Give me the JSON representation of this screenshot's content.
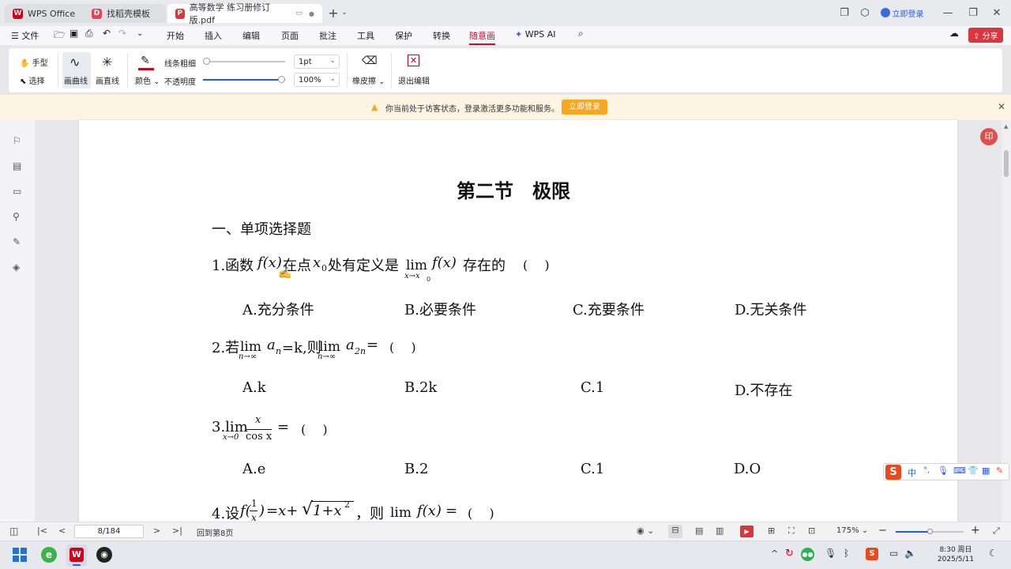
{
  "tabs": [
    {
      "label": "WPS Office",
      "icon": "wps-logo-icon"
    },
    {
      "label": "找稻壳模板",
      "icon": "docer-icon"
    },
    {
      "label": "高等数学 练习册修订版.pdf",
      "icon": "pdf-icon"
    }
  ],
  "titlebar": {
    "login": "立即登录"
  },
  "menu": {
    "file": "文件",
    "items": [
      "开始",
      "插入",
      "编辑",
      "页面",
      "批注",
      "工具",
      "保护",
      "转换",
      "随意画"
    ],
    "ai": "WPS AI",
    "share": "分享"
  },
  "ribbon": {
    "hand": "手型",
    "select": "选择",
    "curve": "画曲线",
    "line": "画直线",
    "color": "颜色",
    "thickness_label": "线条粗细",
    "opacity_label": "不透明度",
    "thickness_value": "1pt",
    "opacity_value": "100%",
    "eraser": "橡皮擦",
    "exit": "退出编辑",
    "thickness_level": 0.0,
    "opacity_level": 1.0
  },
  "notice": {
    "text": "你当前处于访客状态，登录激活更多功能和服务。",
    "button": "立即登录"
  },
  "doc": {
    "title": "第二节　极限",
    "section": "一、单项选择题",
    "q1": {
      "p1": "1.函数",
      "fx": "f(x)",
      "p2": "在点",
      "x0": "x",
      "x0sub": "0",
      "p3": "处有定义是",
      "lim": "lim",
      "limsub": "x→x",
      "limsub0": "0",
      "fx2": "f(x)",
      "p4": "存在的",
      "paren": "(　 )"
    },
    "q1opts": [
      "A.充分条件",
      "B.必要条件",
      "C.充要条件",
      "D.无关条件"
    ],
    "q2": {
      "p1": "2.若",
      "lim": "lim",
      "sub": "n→∞",
      "a": "a",
      "an": "n",
      "p2": "=k,则",
      "lim2": "lim",
      "sub2": "n→∞",
      "a2": "a",
      "a2n": "2n",
      "p3": "=",
      "paren": "(　 )"
    },
    "q2opts": [
      "A.k",
      "B.2k",
      "C.1",
      "D.不存在"
    ],
    "q3": {
      "p1": "3.lim",
      "sub": "x→0",
      "num": "x",
      "den": "cos x",
      "p2": "=",
      "paren": "(　 )"
    },
    "q3opts": [
      "A.e",
      "B.2",
      "C.1",
      "D.O"
    ],
    "q4": {
      "p1": "4.设",
      "f": "f(",
      "num": "1",
      "den": "x",
      "close": ")",
      "p2": "=x+",
      "root": "1+x",
      "sup": "2",
      "p3": "，则",
      "lim": "lim",
      "fx": "f(x)",
      "p4": "=",
      "paren": "(　 )"
    }
  },
  "status": {
    "page_value": "8/184",
    "back": "回到第8页",
    "zoom": "175%"
  },
  "taskbar": {
    "time": "8:30 周日",
    "date": "2025/5/11"
  },
  "ime": {
    "label": "中"
  },
  "side_badge": "印",
  "colors": {
    "accent": "#c8102e",
    "orange": "#f5a623",
    "notice_bg": "#fdf4e3"
  }
}
